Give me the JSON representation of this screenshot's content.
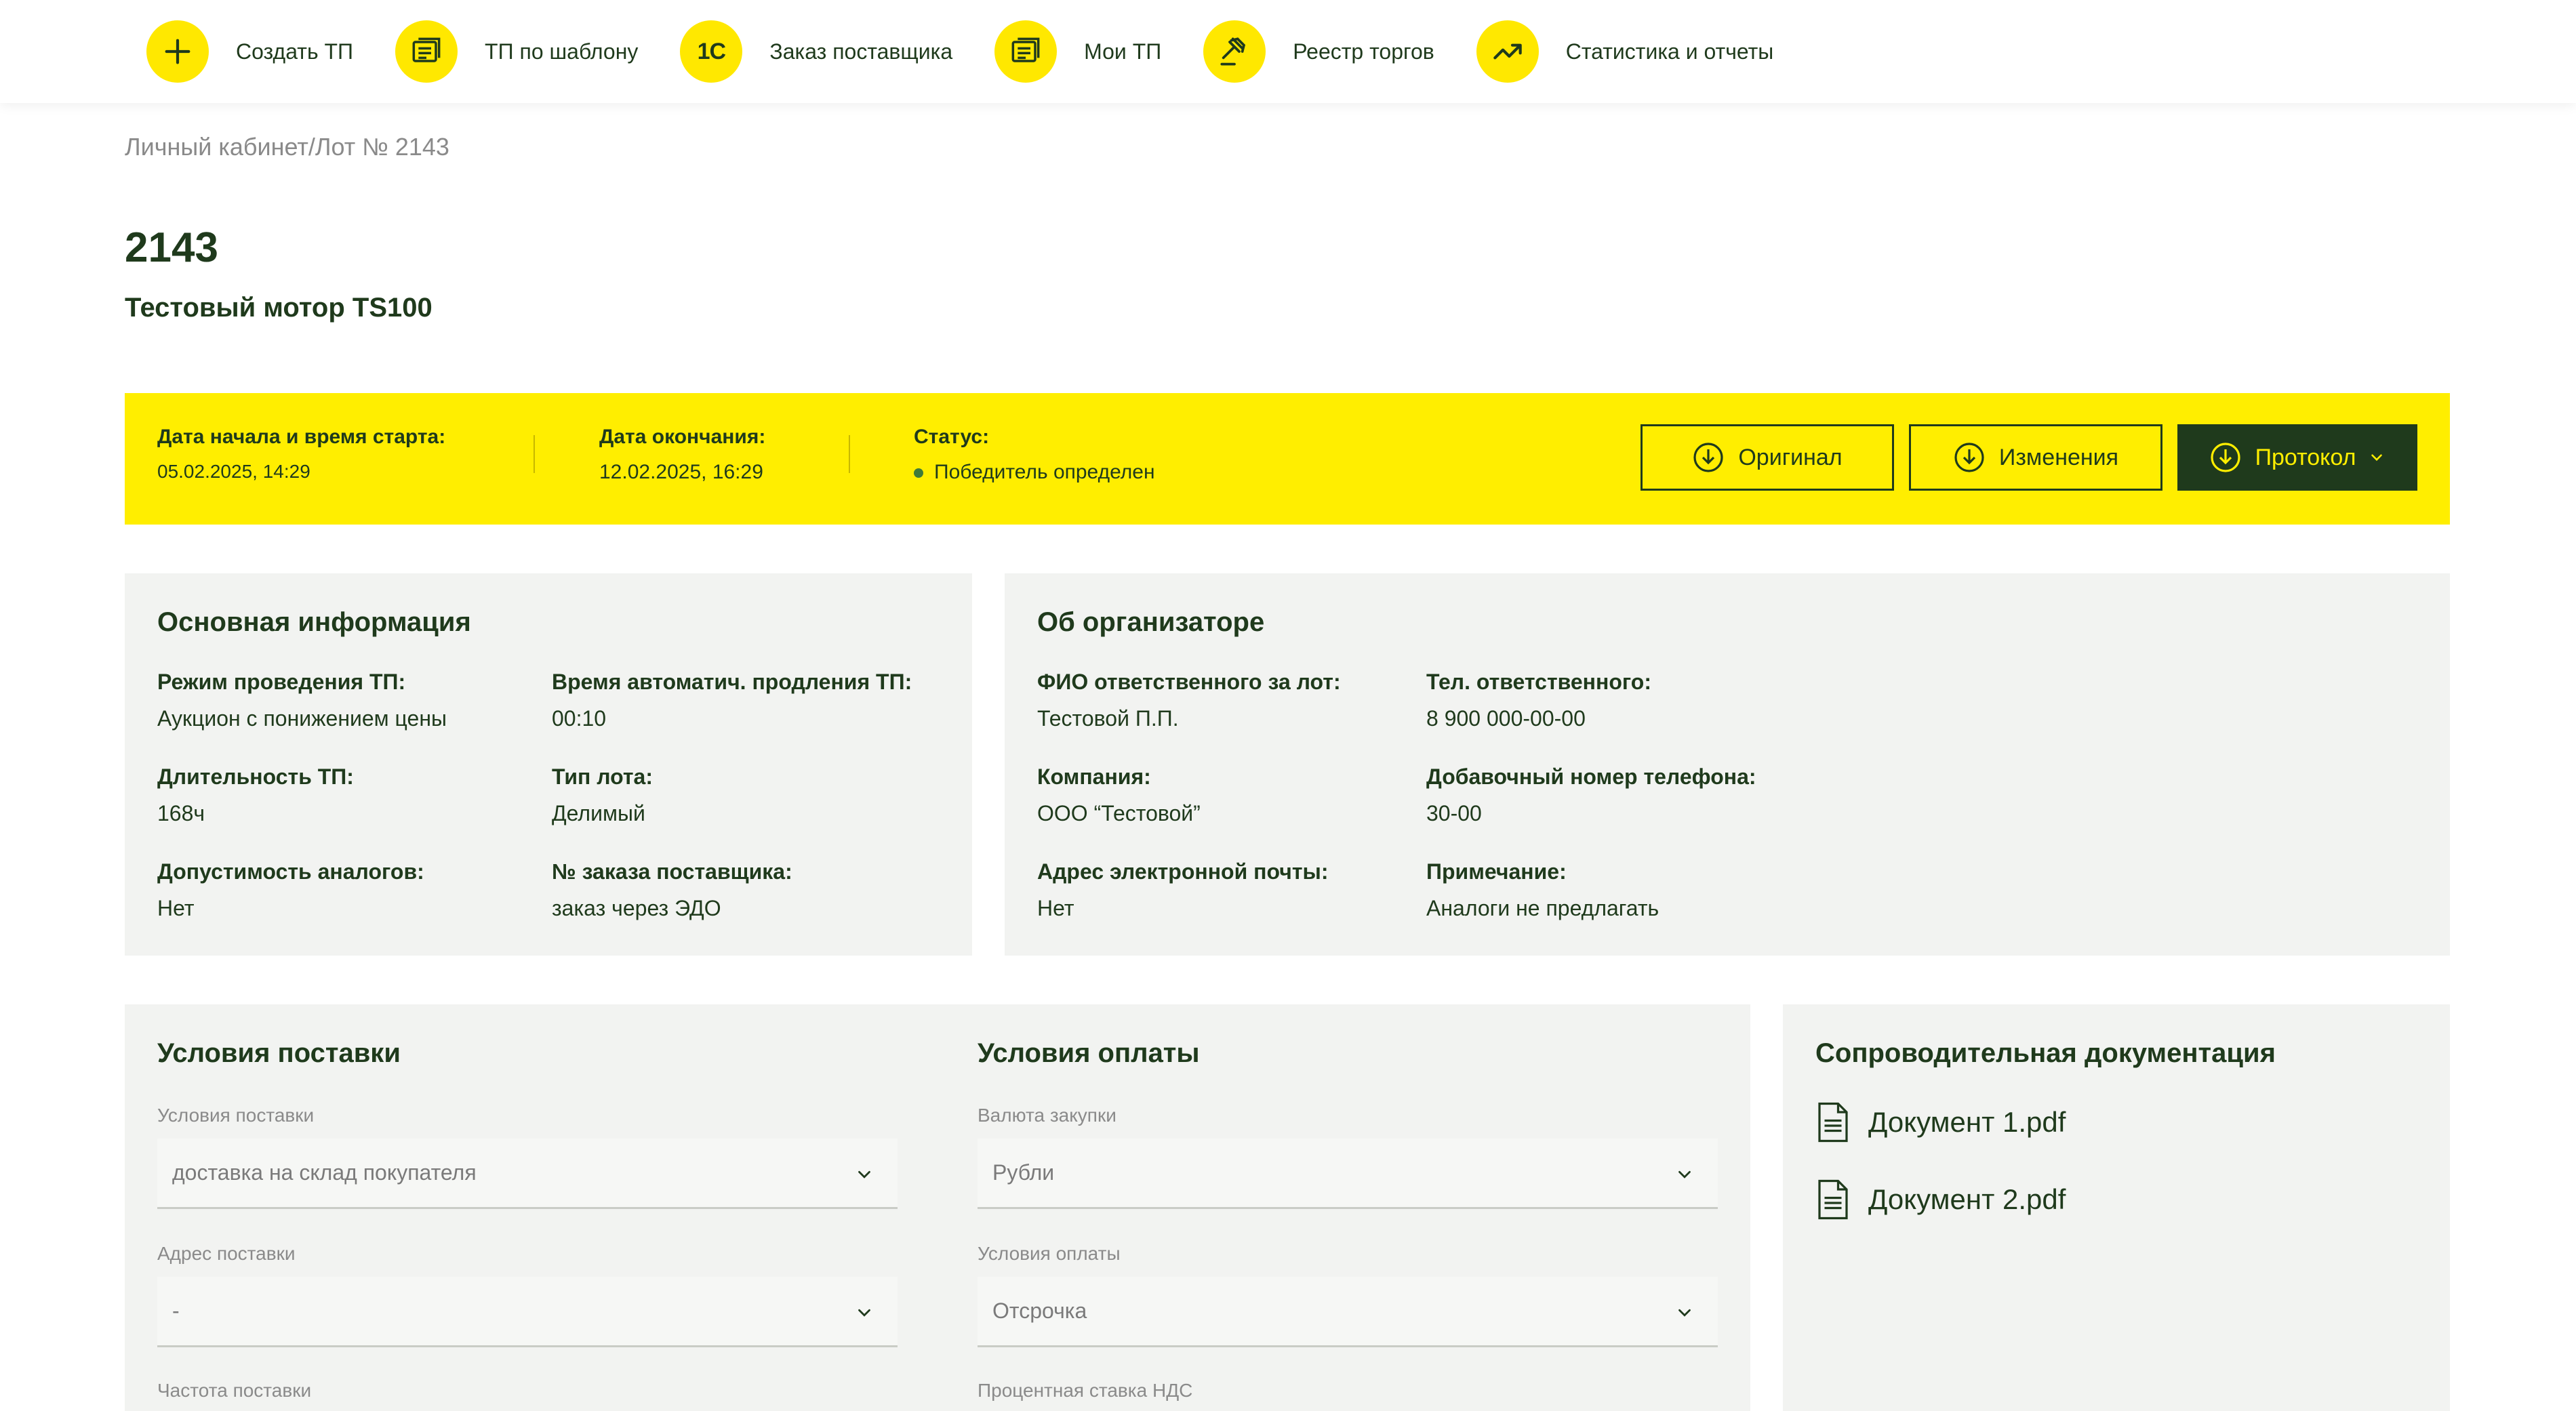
{
  "nav": {
    "items": [
      {
        "label": "Создать ТП",
        "icon": "plus-icon"
      },
      {
        "label": "ТП по шаблону",
        "icon": "template-icon"
      },
      {
        "label": "Заказ поставщика",
        "icon": "1c-logo-icon",
        "icon_text": "1С"
      },
      {
        "label": "Мои ТП",
        "icon": "list-icon"
      },
      {
        "label": "Реестр торгов",
        "icon": "gavel-icon"
      },
      {
        "label": "Статистика и отчеты",
        "icon": "trend-chart-icon"
      }
    ]
  },
  "breadcrumb": "Личный кабинет/Лот № 2143",
  "lot": {
    "number": "2143",
    "title": "Тестовый мотор TS100"
  },
  "status_band": {
    "start_label": "Дата начала и время старта:",
    "start_value": "05.02.2025, 14:29",
    "end_label": "Дата окончания:",
    "end_value": "12.02.2025, 16:29",
    "status_label": "Статус:",
    "status_value": "Победитель определен",
    "buttons": {
      "original": "Оригинал",
      "changes": "Изменения",
      "protocol": "Протокол"
    }
  },
  "basic_info": {
    "title": "Основная информация",
    "fields": [
      {
        "label": "Режим проведения ТП:",
        "value": "Аукцион с понижением цены"
      },
      {
        "label": "Время автоматич. продления ТП:",
        "value": "00:10"
      },
      {
        "label": "Длительность ТП:",
        "value": "168ч"
      },
      {
        "label": "Тип лота:",
        "value": "Делимый"
      },
      {
        "label": "Допустимость аналогов:",
        "value": "Нет"
      },
      {
        "label": "№ заказа поставщика:",
        "value": "заказ через ЭДО"
      }
    ]
  },
  "organizer": {
    "title": "Об организаторе",
    "fields": [
      {
        "label": "ФИО ответственного за лот:",
        "value": "Тестовой П.П."
      },
      {
        "label": "Тел. ответственного:",
        "value": "8 900 000-00-00"
      },
      {
        "label": "Компания:",
        "value": "ООО “Тестовой”"
      },
      {
        "label": "Добавочный номер телефона:",
        "value": "30-00"
      },
      {
        "label": "Адрес электронной почты:",
        "value": "Нет"
      },
      {
        "label": "Примечание:",
        "value": "Аналоги не предлагать"
      }
    ]
  },
  "delivery": {
    "title": "Условия поставки",
    "fields": [
      {
        "label": "Условия поставки",
        "value": "доставка на склад покупателя"
      },
      {
        "label": "Адрес поставки",
        "value": "-"
      },
      {
        "label": "Частота поставки"
      }
    ]
  },
  "payment": {
    "title": "Условия оплаты",
    "fields": [
      {
        "label": "Валюта закупки",
        "value": "Рубли"
      },
      {
        "label": "Условия оплаты",
        "value": "Отсрочка"
      },
      {
        "label": "Процентная ставка НДС"
      }
    ]
  },
  "docs": {
    "title": "Сопроводительная документация",
    "items": [
      "Документ 1.pdf",
      "Документ 2.pdf"
    ]
  },
  "colors": {
    "accent_yellow": "#ffee00",
    "dark_green": "#1f3a1c",
    "card_bg": "#f2f3f1"
  }
}
